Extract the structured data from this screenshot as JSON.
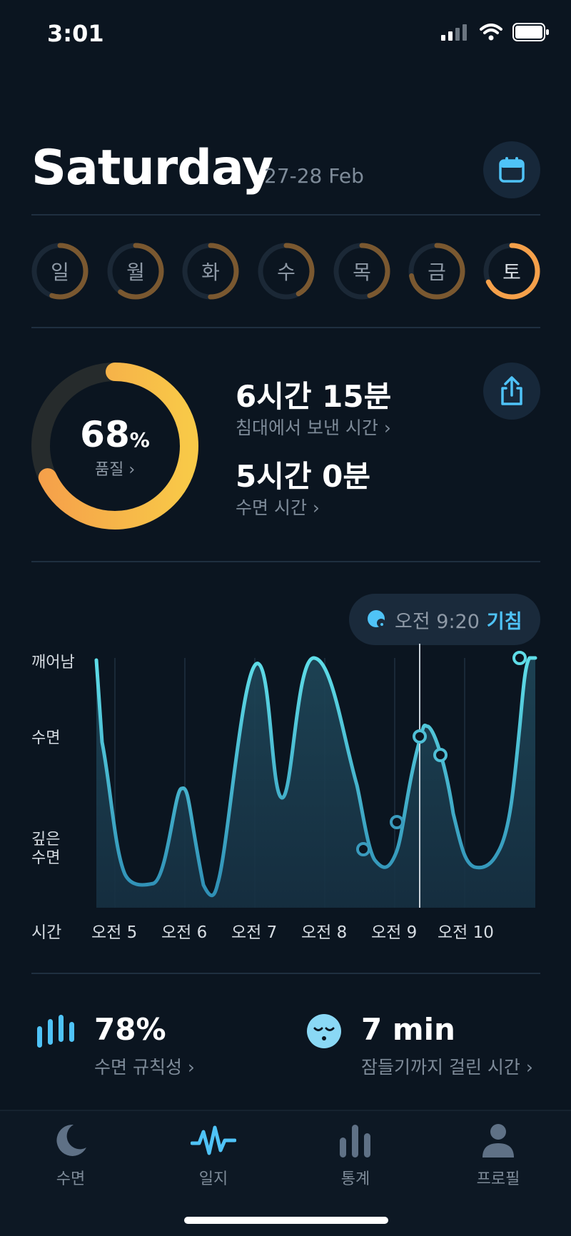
{
  "status": {
    "time": "3:01"
  },
  "header": {
    "day": "Saturday",
    "date_range": "27-28 Feb",
    "calendar_icon": "calendar-icon"
  },
  "week": {
    "days": [
      {
        "label": "일",
        "progress": 0.55,
        "active": false
      },
      {
        "label": "월",
        "progress": 0.6,
        "active": false
      },
      {
        "label": "화",
        "progress": 0.5,
        "active": false
      },
      {
        "label": "수",
        "progress": 0.42,
        "active": false
      },
      {
        "label": "목",
        "progress": 0.45,
        "active": false
      },
      {
        "label": "금",
        "progress": 0.72,
        "active": false
      },
      {
        "label": "토",
        "progress": 0.68,
        "active": true
      }
    ]
  },
  "quality": {
    "percent": "68",
    "symbol": "%",
    "label": "품질 ›",
    "value": 0.68
  },
  "time_in_bed": {
    "value": "6시간 15분",
    "label": "침대에서 보낸 시간 ›"
  },
  "sleep_time": {
    "value": "5시간 0분",
    "label": "수면 시간 ›"
  },
  "wake": {
    "time": "오전 9:20",
    "label": "기침"
  },
  "chart_data": {
    "type": "line",
    "ylabels": [
      "깨어남",
      "수면",
      "깊은 수면"
    ],
    "xlabel": "시간",
    "categories": [
      "오전 5",
      "오전 6",
      "오전 7",
      "오전 8",
      "오전 9",
      "오전 10"
    ]
  },
  "chart": {
    "y_awake": "깨어남",
    "y_sleep": "수면",
    "y_deep_1": "깊은",
    "y_deep_2": "수면",
    "x_title": "시간",
    "x_ticks": [
      "오전 5",
      "오전 6",
      "오전 7",
      "오전 8",
      "오전 9",
      "오전 10"
    ]
  },
  "regularity": {
    "value": "78%",
    "label": "수면 규칙성 ›"
  },
  "latency": {
    "value": "7 min",
    "label": "잠들기까지 걸린 시간 ›"
  },
  "tabs": [
    {
      "label": "수면",
      "icon": "moon-icon",
      "active": false
    },
    {
      "label": "일지",
      "icon": "pulse-icon",
      "active": true
    },
    {
      "label": "통계",
      "icon": "bar-chart-icon",
      "active": false
    },
    {
      "label": "프로필",
      "icon": "person-icon",
      "active": false
    }
  ],
  "colors": {
    "accent_orange": "#f5a04a",
    "accent_blue": "#4fc3f7",
    "background": "#0b1520"
  }
}
